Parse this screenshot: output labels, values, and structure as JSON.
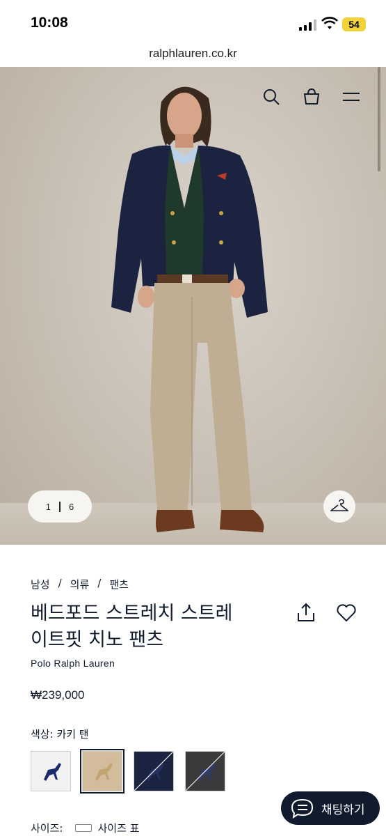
{
  "status": {
    "time": "10:08",
    "battery": "54"
  },
  "browser": {
    "url": "ralphlauren.co.kr"
  },
  "gallery": {
    "current": "1",
    "total": "6"
  },
  "breadcrumb": {
    "items": [
      "남성",
      "의류",
      "팬츠"
    ],
    "separator": "/"
  },
  "product": {
    "title_line1": "베드포드 스트레치 스트레",
    "title_line2": "이트핏 치노 팬츠",
    "brand": "Polo Ralph Lauren",
    "price": "₩239,000"
  },
  "color": {
    "label": "색상:",
    "value": "카키 탠"
  },
  "size": {
    "label": "사이즈:",
    "guide": "사이즈 표"
  },
  "chat": {
    "label": "채팅하기"
  },
  "colors": {
    "navy": "#111b2e",
    "accent_yellow": "#f2d23a"
  }
}
